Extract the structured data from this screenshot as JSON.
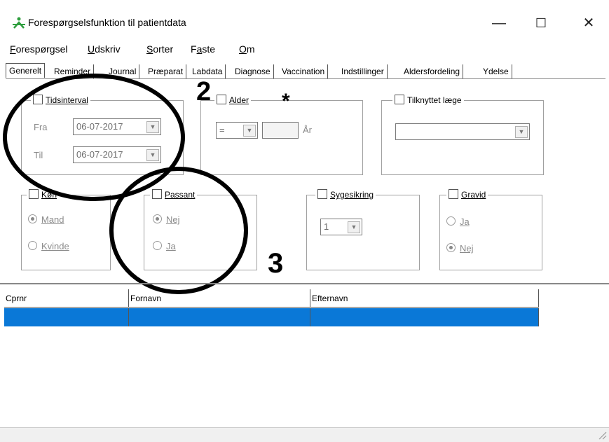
{
  "window": {
    "title": "Forespørgselsfunktion til patientdata",
    "minimize_glyph": "—",
    "maximize_glyph": "☐",
    "close_glyph": "✕"
  },
  "menu": [
    {
      "first": "F",
      "rest": "orespørgsel"
    },
    {
      "first": "U",
      "rest": "dskriv"
    },
    {
      "first": "S",
      "rest": "orter"
    },
    {
      "first": "F",
      "rest": "aste",
      "underline_index": 1,
      "label": "Faste"
    },
    {
      "first": "O",
      "rest": "m"
    }
  ],
  "tabs": [
    "Generelt",
    "Reminder",
    "Journal",
    "Præparat",
    "Labdata",
    "Diagnose",
    "Vaccination",
    "Indstillinger",
    "Aldersfordeling",
    "Ydelse"
  ],
  "tidsinterval": {
    "label": "Tidsinterval",
    "fra_label": "Fra",
    "fra_value": "06-07-2017",
    "til_label": "Til",
    "til_value": "06-07-2017"
  },
  "alder": {
    "label": "Alder",
    "operator": "=",
    "unit": "År"
  },
  "tilknyttet": {
    "label": "Tilknyttet læge",
    "value": ""
  },
  "koen": {
    "label": "Køn",
    "options": [
      "Mand",
      "Kvinde"
    ],
    "selected": "Mand"
  },
  "passant": {
    "label": "Passant",
    "options": [
      "Nej",
      "Ja"
    ],
    "selected": "Nej"
  },
  "sygesikring": {
    "label": "Sygesikring",
    "value": "1"
  },
  "gravid": {
    "label": "Gravid",
    "options": [
      "Ja",
      "Nej"
    ],
    "selected": "Nej"
  },
  "annotations": {
    "two": "2",
    "star": "*",
    "three": "3"
  },
  "grid": {
    "columns": [
      "Cprnr",
      "Fornavn",
      "Efternavn"
    ]
  },
  "colors": {
    "selection": "#0a78d7",
    "app_icon": "#2e9e3e"
  }
}
